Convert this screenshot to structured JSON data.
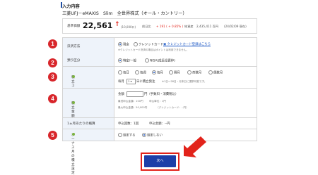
{
  "section_title": "入力内容",
  "fund": {
    "name": "三菱UFJ－eMAXIS　Slim　全世界株式（オール・カントリー）",
    "price_label": "基準価額",
    "price": "22,561",
    "unit": "(10,000口)",
    "change_label": "前日比",
    "change": "+ 191 ( + 0.85% )",
    "assets_label": "純資産",
    "assets": "2,435,411 百円",
    "asof": "(24/02/09 現在)"
  },
  "form": {
    "payment": {
      "badge": "1",
      "label": "決済方法",
      "opt_cash": "現金",
      "opt_card": "クレジットカード",
      "card_link": "クレジットカード登録はこちら",
      "note": "※クレジットカード決済の場合はポイントは利用できません。"
    },
    "account": {
      "badge": "2",
      "label": "預り区分",
      "opt_tokutei": "特定/一般",
      "opt_nisa": "NISA(成長投資枠)"
    },
    "course": {
      "badge": "3",
      "label": "積立コースと申込設定日",
      "opt_daily": "毎日",
      "opt_weekly": "毎週",
      "opt_monthly": "毎月",
      "opt_odd": "隔月",
      "opt_even": "奇数月",
      "opt_even2": "偶数月",
      "monthly_prefix": "毎月",
      "day_select": "1",
      "monthly_suffix": "日に積立発注",
      "monthly_note": "※1日～28日・月末日に選択可能です。"
    },
    "amount": {
      "badge": "4",
      "label": "積立金額",
      "prefix": "金額",
      "unit": "円（手数料・消費税込）",
      "min_label": "最低申込金額：100円",
      "unit_label": "申込単位：1円",
      "max_label": "最大申込金額：50,000円",
      "card_max": "（クレジットカード：--円）"
    },
    "monthly_total": {
      "label": "1ヵ月あたりの概算",
      "count_label": "申込回数：1回",
      "sum_label": "申込金額：--円"
    },
    "bonus": {
      "badge": "5",
      "label": "ボーナス月の積立設定",
      "opt_set": "設定する",
      "opt_none": "設定しない"
    }
  },
  "next_button": "次へ",
  "colors": {
    "badge": "#d8262b",
    "button": "#1d3fa8",
    "highlight": "#e2231a",
    "label_bg": "#eef3fa"
  }
}
